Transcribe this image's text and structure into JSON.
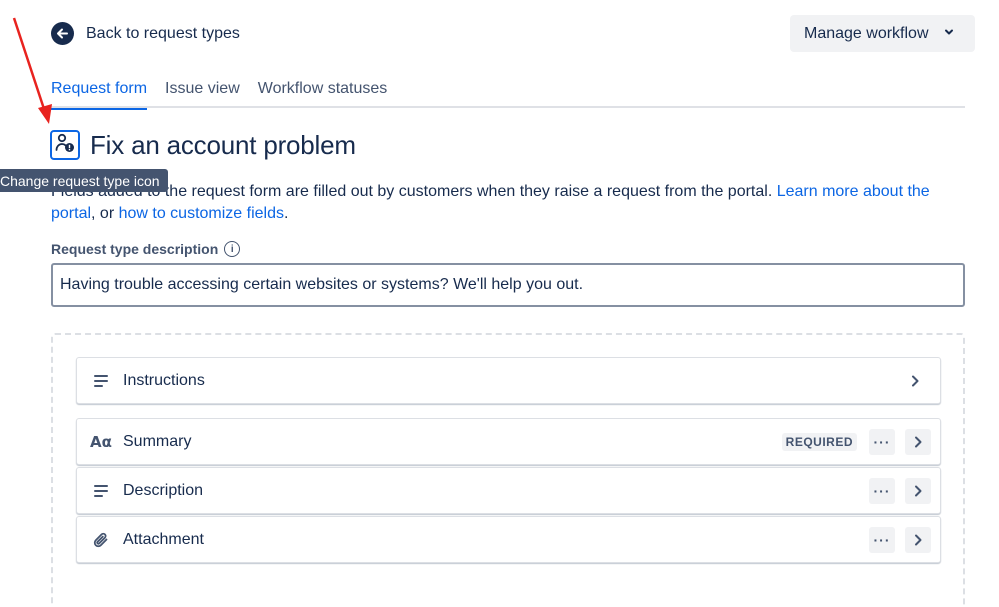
{
  "header": {
    "back_label": "Back to request types",
    "manage_workflow_label": "Manage workflow"
  },
  "tabs": [
    {
      "label": "Request form",
      "active": true
    },
    {
      "label": "Issue view",
      "active": false
    },
    {
      "label": "Workflow statuses",
      "active": false
    }
  ],
  "request_type": {
    "title": "Fix an account problem",
    "icon": "person-lock-icon",
    "tooltip": "Change request type icon"
  },
  "intro": {
    "text_before": "Fields added to the request form are filled out by customers when they raise a request from the portal. ",
    "link1": "Learn more about the portal",
    "text_middle": ", or ",
    "link2": "how to customize fields",
    "text_after": "."
  },
  "description_field": {
    "label": "Request type description",
    "value": "Having trouble accessing certain websites or systems? We'll help you out."
  },
  "form_fields": [
    {
      "label": "Instructions",
      "icon": "text-lines-icon"
    },
    {
      "label": "Summary",
      "icon": "text-aa-icon",
      "badge": "REQUIRED"
    },
    {
      "label": "Description",
      "icon": "text-lines-icon"
    },
    {
      "label": "Attachment",
      "icon": "paperclip-icon"
    }
  ],
  "colors": {
    "accent": "#0c66e4",
    "text": "#172b4d",
    "annotation_arrow": "#e8231f"
  }
}
